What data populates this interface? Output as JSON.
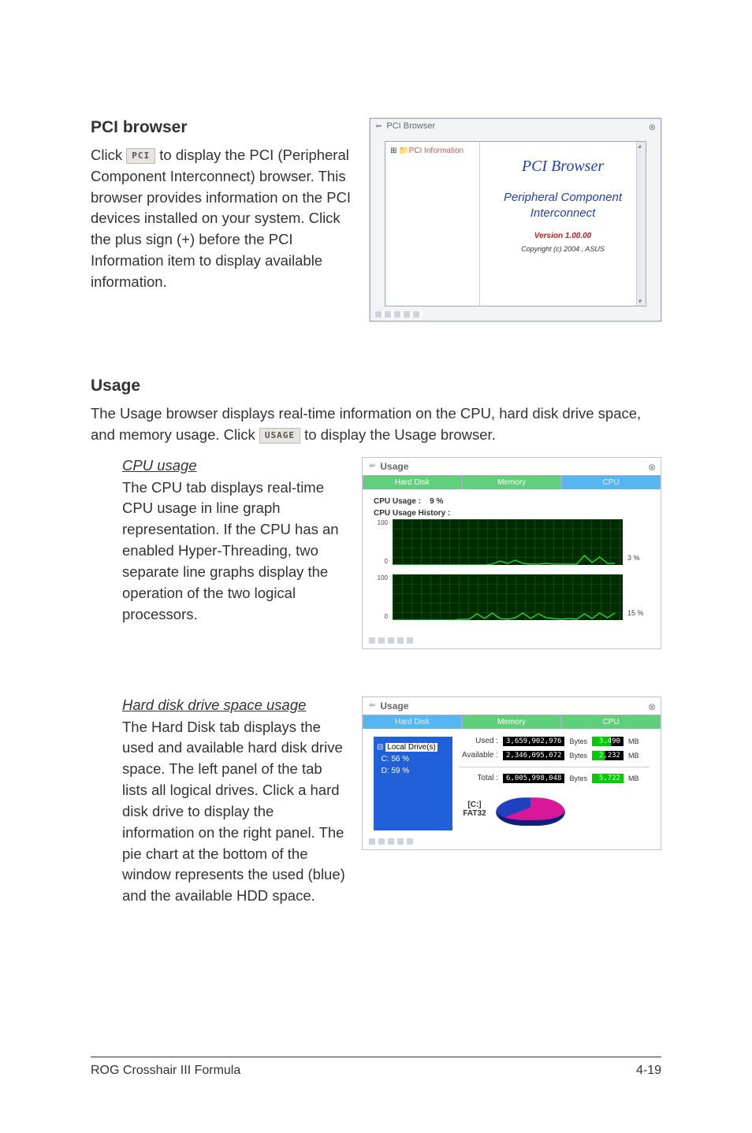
{
  "pci_section": {
    "title": "PCI browser",
    "text_before_icon": "Click ",
    "icon_label": "PCI",
    "text_after_icon": " to display the PCI (Peripheral Component Interconnect) browser. This browser provides information on the PCI devices installed on your system. Click the plus sign (+) before the PCI Information item to display available information."
  },
  "pci_window": {
    "title": "PCI Browser",
    "tree_root": "PCI Information",
    "heading": "PCI  Browser",
    "subheading1": "Peripheral Component",
    "subheading2": "Interconnect",
    "version": "Version 1.00.00",
    "copyright": "Copyright (c) 2004 ,  ASUS"
  },
  "usage_section": {
    "title": "Usage",
    "para_before_icon": "The Usage browser displays real-time information on the CPU, hard disk drive space, and memory usage. Click ",
    "icon_label": "USAGE",
    "para_after_icon": " to display the Usage browser."
  },
  "cpu_usage": {
    "heading": "CPU usage",
    "text": "The CPU tab displays real-time CPU usage in line graph representation. If the CPU has an enabled Hyper-Threading, two separate line graphs display the operation of the two logical processors."
  },
  "cpu_window": {
    "title": "Usage",
    "tabs": {
      "hdd": "Hard Disk",
      "mem": "Memory",
      "cpu": "CPU"
    },
    "cpu_usage_label": "CPU Usage :",
    "cpu_usage_value": "9  %",
    "history_label": "CPU Usage History :",
    "y_top": "100",
    "y_bot": "0",
    "graph1_pct": "3 %",
    "graph2_pct": "15 %"
  },
  "hdd_usage": {
    "heading": "Hard disk drive space usage",
    "text": "The Hard Disk tab displays the used and available hard disk drive space. The left panel of the tab lists all logical drives. Click a hard disk drive to display the information on the right panel. The pie chart at the bottom of the window represents the used (blue) and the available HDD space."
  },
  "hdd_window": {
    "title": "Usage",
    "tabs": {
      "hdd": "Hard Disk",
      "mem": "Memory",
      "cpu": "CPU"
    },
    "tree_root": "Local Drive(s)",
    "tree_c": "C: 56 %",
    "tree_d": "D: 59 %",
    "rows": {
      "used": {
        "label": "Used :",
        "bytes": "3,659,902,976",
        "unit_b": "Bytes",
        "mb": "3,490",
        "unit_m": "MB"
      },
      "avail": {
        "label": "Available :",
        "bytes": "2,346,095,072",
        "unit_b": "Bytes",
        "mb": "2,232",
        "unit_m": "MB"
      },
      "total": {
        "label": "Total :",
        "bytes": "6,005,998,048",
        "unit_b": "Bytes",
        "mb": "5,722",
        "unit_m": "MB"
      }
    },
    "drive_name": "[C:]",
    "fs": "FAT32"
  },
  "chart_data": [
    {
      "type": "line",
      "title": "CPU Usage History — Logical CPU 0",
      "ylim": [
        0,
        100
      ],
      "x": [
        0,
        1,
        2,
        3,
        4,
        5,
        6,
        7,
        8,
        9,
        10,
        11,
        12,
        13,
        14,
        15,
        16,
        17,
        18,
        19,
        20,
        21,
        22,
        23,
        24,
        25,
        26,
        27,
        28,
        29
      ],
      "values": [
        0,
        0,
        0,
        0,
        0,
        0,
        0,
        0,
        0,
        0,
        0,
        0,
        0,
        2,
        8,
        3,
        10,
        4,
        2,
        1,
        3,
        2,
        2,
        1,
        2,
        20,
        5,
        18,
        4,
        3
      ],
      "current_label": "3 %"
    },
    {
      "type": "line",
      "title": "CPU Usage History — Logical CPU 1",
      "ylim": [
        0,
        100
      ],
      "x": [
        0,
        1,
        2,
        3,
        4,
        5,
        6,
        7,
        8,
        9,
        10,
        11,
        12,
        13,
        14,
        15,
        16,
        17,
        18,
        19,
        20,
        21,
        22,
        23,
        24,
        25,
        26,
        27,
        28,
        29
      ],
      "values": [
        0,
        0,
        0,
        0,
        0,
        0,
        0,
        0,
        0,
        1,
        2,
        14,
        4,
        16,
        4,
        2,
        6,
        16,
        4,
        14,
        6,
        4,
        2,
        3,
        2,
        14,
        4,
        16,
        6,
        15
      ],
      "current_label": "15 %"
    },
    {
      "type": "pie",
      "title": "[C:] FAT32 disk usage",
      "categories": [
        "Available",
        "Used"
      ],
      "values": [
        2346095072,
        3659902976
      ],
      "values_mb": [
        2232,
        3490
      ],
      "colors": [
        "#d81898",
        "#2040c0"
      ]
    }
  ],
  "footer": {
    "left": "ROG Crosshair III Formula",
    "right": "4-19"
  }
}
